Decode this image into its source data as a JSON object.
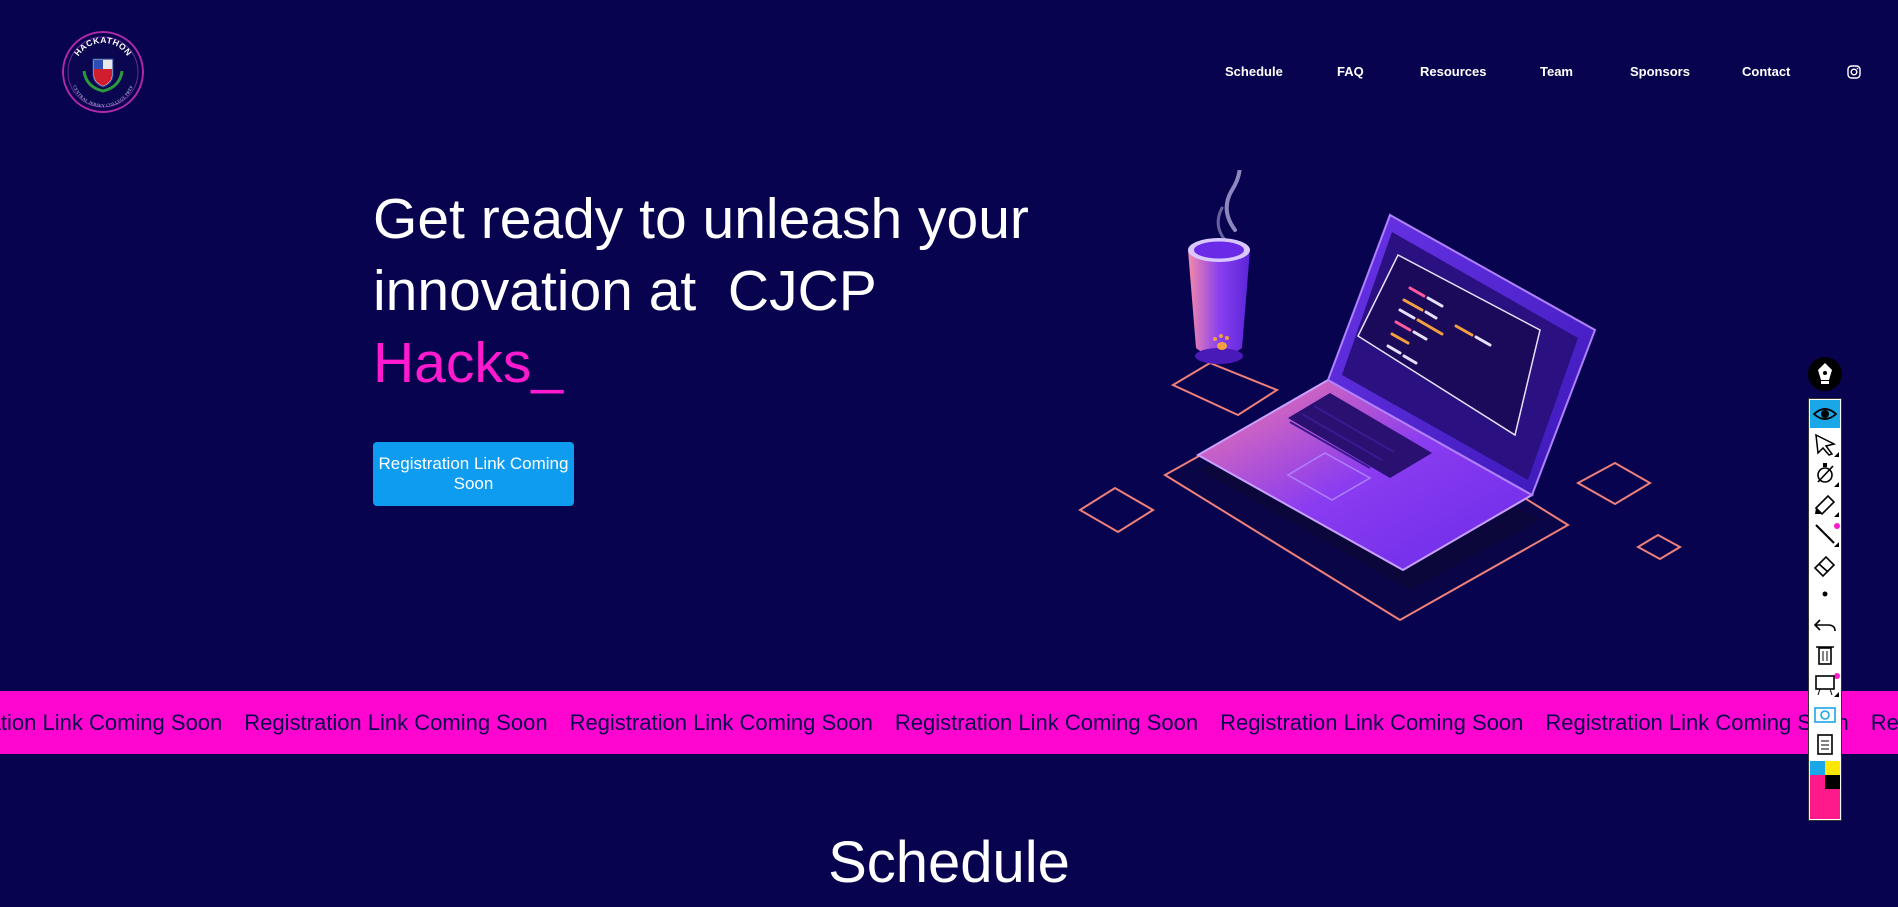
{
  "header": {
    "logo": {
      "top_text": "HACKATHON",
      "bottom_text": "CENTRAL JERSEY COLLEGE PREP",
      "icon": "school-crest-icon"
    },
    "nav": [
      {
        "label": "Schedule"
      },
      {
        "label": "FAQ"
      },
      {
        "label": "Resources"
      },
      {
        "label": "Team"
      },
      {
        "label": "Sponsors"
      },
      {
        "label": "Contact"
      }
    ],
    "social_icon": "instagram-icon"
  },
  "hero": {
    "title_line1": "Get ready to unleash your",
    "title_line2": "innovation at  CJCP",
    "title_accent": "Hacks_",
    "button_label": "Registration Link Coming Soon"
  },
  "marquee": {
    "items": [
      "Registration Link Coming Soon",
      "Registration Link Coming Soon",
      "Registration Link Coming Soon",
      "Registration Link Coming Soon",
      "Registration Link Coming Soon",
      "Registration Link Coming Soon",
      "Registration Link Coming Soon"
    ]
  },
  "schedule": {
    "title": "Schedule"
  },
  "toolbar": {
    "tools": [
      "pen-icon",
      "eye-icon",
      "select-arrow-icon",
      "color-picker-icon",
      "highlighter-icon",
      "line-icon",
      "eraser-icon",
      "dot-icon",
      "undo-icon",
      "trash-icon",
      "whiteboard-icon",
      "screenshot-icon",
      "notes-icon"
    ]
  },
  "colors": {
    "background": "#07034f",
    "accent_pink": "#ff1ad0",
    "marquee_bg": "#ff05cf",
    "button_blue": "#0d9cf0"
  }
}
